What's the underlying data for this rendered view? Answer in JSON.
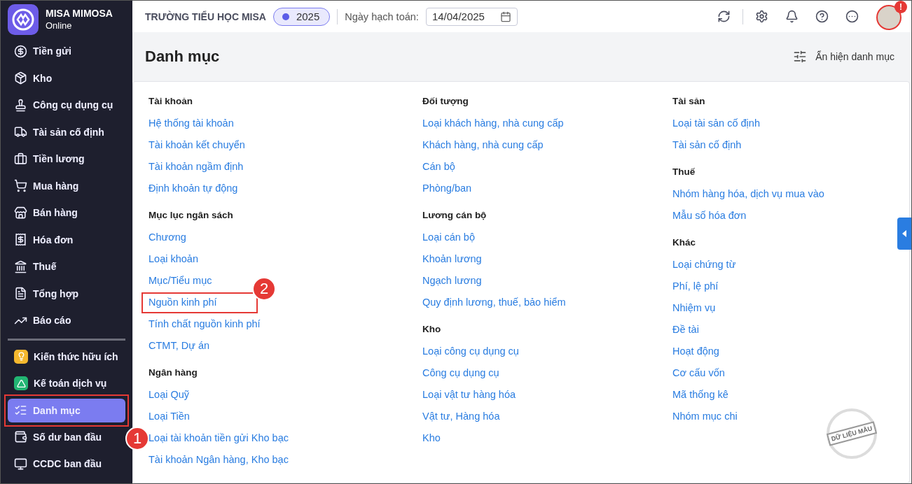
{
  "sidebar": {
    "brand": {
      "name": "MISA MIMOSA",
      "subtitle": "Online"
    },
    "items": [
      {
        "label": "Tiền gửi",
        "kind": "nav",
        "selected": false,
        "highlighted": false
      },
      {
        "label": "Kho",
        "kind": "nav",
        "selected": false,
        "highlighted": false
      },
      {
        "label": "Công cụ dụng cụ",
        "kind": "nav",
        "selected": false,
        "highlighted": false
      },
      {
        "label": "Tài sản cố định",
        "kind": "nav",
        "selected": false,
        "highlighted": false
      },
      {
        "label": "Tiền lương",
        "kind": "nav",
        "selected": false,
        "highlighted": false
      },
      {
        "label": "Mua hàng",
        "kind": "nav",
        "selected": false,
        "highlighted": false
      },
      {
        "label": "Bán hàng",
        "kind": "nav",
        "selected": false,
        "highlighted": false
      },
      {
        "label": "Hóa đơn",
        "kind": "nav",
        "selected": false,
        "highlighted": false
      },
      {
        "label": "Thuế",
        "kind": "nav",
        "selected": false,
        "highlighted": false
      },
      {
        "label": "Tổng hợp",
        "kind": "nav",
        "selected": false,
        "highlighted": false
      },
      {
        "label": "Báo cáo",
        "kind": "nav",
        "selected": false,
        "highlighted": false
      },
      {
        "label": "Kiến thức hữu ích",
        "kind": "feature",
        "selected": false,
        "highlighted": false,
        "color": "#f5b82e"
      },
      {
        "label": "Kế toán dịch vụ",
        "kind": "feature",
        "selected": false,
        "highlighted": false,
        "color": "#22b573"
      },
      {
        "label": "Danh mục",
        "kind": "nav",
        "selected": true,
        "highlighted": true,
        "callout": "1"
      },
      {
        "label": "Số dư ban đầu",
        "kind": "nav",
        "selected": false,
        "highlighted": false
      },
      {
        "label": "CCDC ban đầu",
        "kind": "nav",
        "selected": false,
        "highlighted": false
      }
    ]
  },
  "topbar": {
    "organization": "TRƯỜNG TIỂU HỌC MISA",
    "year": "2025",
    "date_label": "Ngày hạch toán:",
    "date_value": "14/04/2025",
    "notification_alert": "!"
  },
  "page": {
    "title": "Danh mục",
    "toggle_action": "Ẩn hiện danh mục"
  },
  "columns": [
    {
      "groups": [
        {
          "title": "Tài khoản",
          "links": [
            {
              "label": "Hệ thống tài khoản",
              "highlighted": false
            },
            {
              "label": "Tài khoản kết chuyển",
              "highlighted": false
            },
            {
              "label": "Tài khoản ngầm định",
              "highlighted": false
            },
            {
              "label": "Định khoản tự động",
              "highlighted": false
            }
          ]
        },
        {
          "title": "Mục lục ngân sách",
          "links": [
            {
              "label": "Chương",
              "highlighted": false
            },
            {
              "label": "Loại khoản",
              "highlighted": false
            },
            {
              "label": "Mục/Tiểu mục",
              "highlighted": false
            },
            {
              "label": "Nguồn kinh phí",
              "highlighted": true,
              "callout": "2"
            },
            {
              "label": "Tính chất nguồn kinh phí",
              "highlighted": false
            },
            {
              "label": "CTMT, Dự án",
              "highlighted": false
            }
          ]
        },
        {
          "title": "Ngân hàng",
          "links": [
            {
              "label": "Loại Quỹ",
              "highlighted": false
            },
            {
              "label": "Loại Tiền",
              "highlighted": false
            },
            {
              "label": "Loại tài khoản tiền gửi Kho bạc",
              "highlighted": false
            },
            {
              "label": "Tài khoản Ngân hàng, Kho bạc",
              "highlighted": false
            }
          ]
        }
      ]
    },
    {
      "groups": [
        {
          "title": "Đối tượng",
          "links": [
            {
              "label": "Loại khách hàng, nhà cung cấp",
              "highlighted": false
            },
            {
              "label": "Khách hàng, nhà cung cấp",
              "highlighted": false
            },
            {
              "label": "Cán bộ",
              "highlighted": false
            },
            {
              "label": "Phòng/ban",
              "highlighted": false
            }
          ]
        },
        {
          "title": "Lương cán bộ",
          "links": [
            {
              "label": "Loại cán bộ",
              "highlighted": false
            },
            {
              "label": "Khoản lương",
              "highlighted": false
            },
            {
              "label": "Ngạch lương",
              "highlighted": false
            },
            {
              "label": "Quy định lương, thuế, bảo hiểm",
              "highlighted": false
            }
          ]
        },
        {
          "title": "Kho",
          "links": [
            {
              "label": "Loại công cụ dụng cụ",
              "highlighted": false
            },
            {
              "label": "Công cụ dụng cụ",
              "highlighted": false
            },
            {
              "label": "Loại vật tư hàng hóa",
              "highlighted": false
            },
            {
              "label": "Vật tư, Hàng hóa",
              "highlighted": false
            },
            {
              "label": "Kho",
              "highlighted": false
            }
          ]
        }
      ]
    },
    {
      "groups": [
        {
          "title": "Tài sản",
          "links": [
            {
              "label": "Loại tài sản cố định",
              "highlighted": false
            },
            {
              "label": "Tài sản cố định",
              "highlighted": false
            }
          ]
        },
        {
          "title": "Thuế",
          "links": [
            {
              "label": "Nhóm hàng hóa, dịch vụ mua vào",
              "highlighted": false
            },
            {
              "label": "Mẫu số hóa đơn",
              "highlighted": false
            }
          ]
        },
        {
          "title": "Khác",
          "links": [
            {
              "label": "Loại chứng từ",
              "highlighted": false
            },
            {
              "label": "Phí, lệ phí",
              "highlighted": false
            },
            {
              "label": "Nhiệm vụ",
              "highlighted": false
            },
            {
              "label": "Đề tài",
              "highlighted": false
            },
            {
              "label": "Hoạt động",
              "highlighted": false
            },
            {
              "label": "Cơ cấu vốn",
              "highlighted": false
            },
            {
              "label": "Mã thống kê",
              "highlighted": false
            },
            {
              "label": "Nhóm mục chi",
              "highlighted": false
            }
          ]
        }
      ]
    }
  ],
  "stamp": "DỮ LIỆU MẪU"
}
